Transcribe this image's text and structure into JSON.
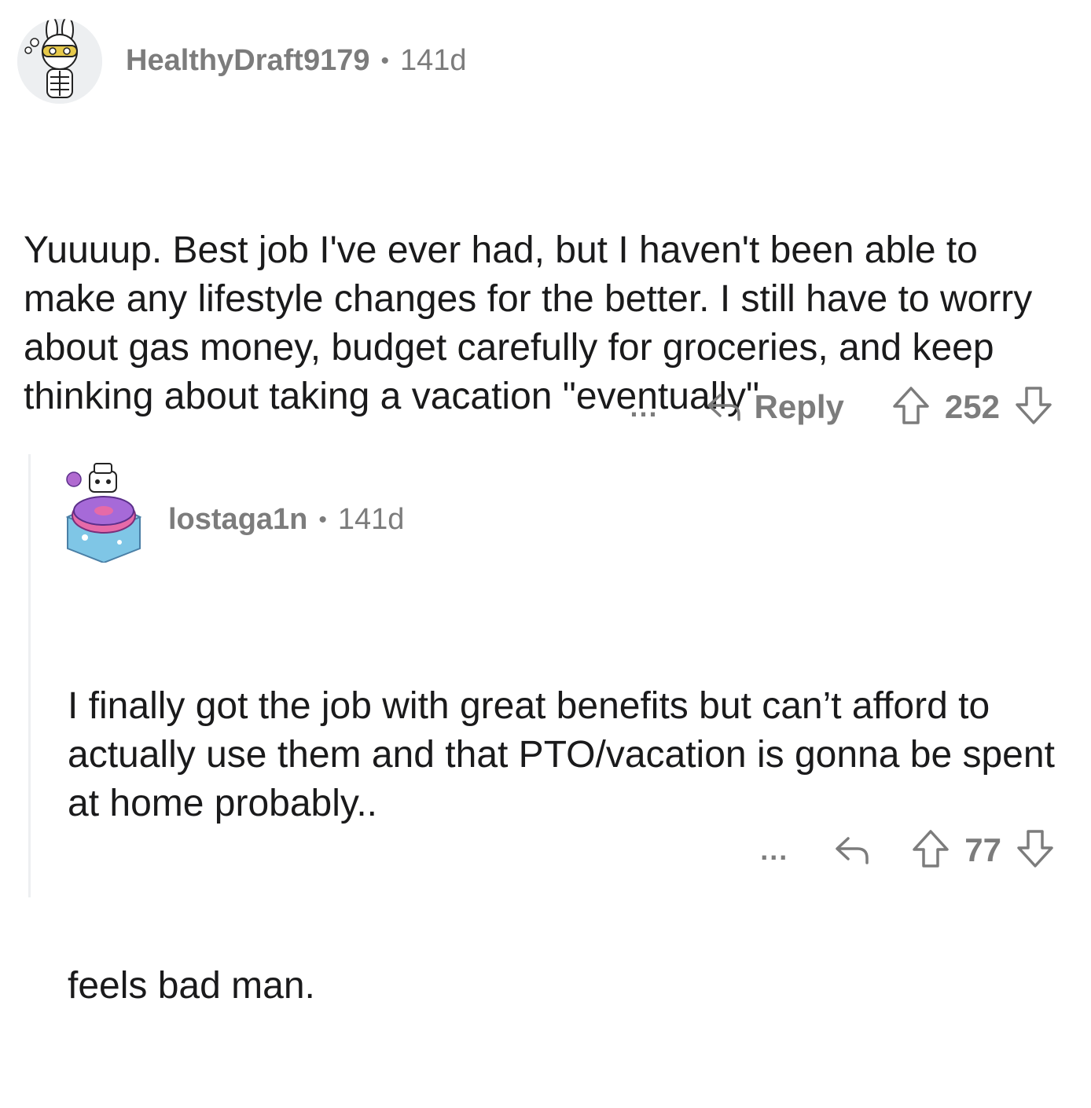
{
  "parent_comment": {
    "avatar_icon": "bunny-skeleton-avatar-icon",
    "username": "HealthyDraft9179",
    "separator": "•",
    "age": "141d",
    "paragraphs": [
      "Yuuuup. Best job I've ever had, but I haven't been able to make any lifestyle changes for the better. I still have to worry about gas money, budget carefully for groceries, and keep thinking about taking a vacation \"eventually\""
    ],
    "actions": {
      "more_label": "...",
      "reply_label": "Reply",
      "score": "252"
    }
  },
  "reply_comment": {
    "avatar_icon": "donut-cube-avatar-icon",
    "username": "lostaga1n",
    "separator": "•",
    "age": "141d",
    "paragraphs": [
      "I finally got the job with great benefits but can’t afford to actually use them and that PTO/vacation is gonna be spent at home probably..",
      "feels bad man."
    ],
    "actions": {
      "more_label": "...",
      "score": "77"
    }
  },
  "colors": {
    "meta_gray": "#7c7c7c",
    "body_text": "#1a1a1b",
    "thread_line": "#edeff1",
    "avatar_bg": "#edeff1",
    "donut_purple": "#a66ad8",
    "donut_pink": "#e66aa8",
    "cube_blue": "#7fc6e6"
  }
}
